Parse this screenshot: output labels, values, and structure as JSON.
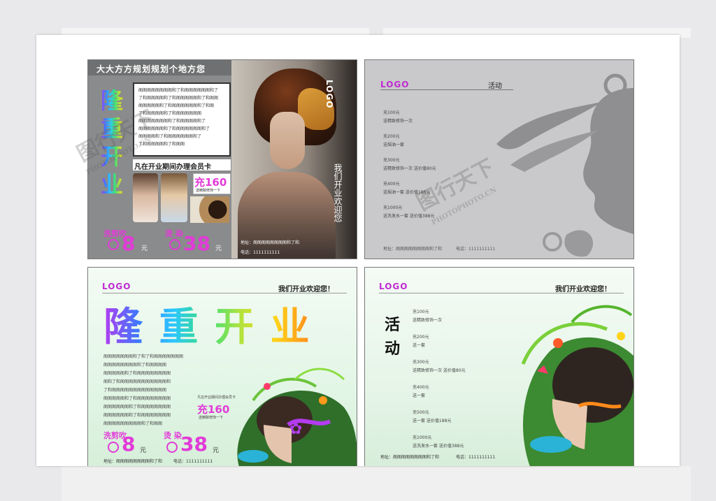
{
  "panel1": {
    "title": "大大方方规划规划个地方您",
    "vertical_title": [
      "隆",
      "重",
      "开",
      "业"
    ],
    "filler_lines": [
      "阁阁阁阁阁阁阁阁和了和阁阁阁阁阁阁和了",
      "了和阁阁阁阁和了和阁阁阁阁阁和了和阁阁",
      "阁阁阁阁阁和了和阁阁阁阁阁阁和了和阁",
      "了和阁阁阁阁和了和阁阁阁阁阁阁",
      "阁阁阁阁阁阁阁和了和阁阁阁阁和了",
      "阁阁阁阁阁阁和了和阁阁阁阁阁阁和了",
      "阁阁阁阁和了和阁阁阁阁阁阁和了",
      "了和阁阁阁阁和了和阁阁"
    ],
    "member_text": "凡在开业期间办理会员卡",
    "charge": "充160",
    "charge_sub": "送精致修饰一下",
    "wash_label": "洗剪吹",
    "wash_price": "8",
    "wash_unit": "元",
    "perm_label": "烫 染",
    "perm_price": "38",
    "perm_unit": "元",
    "logo": "LOGO",
    "welcome_vertical": "我们开业欢迎您",
    "address": "地址：阁阁阁阁阁阁阁阁和了和",
    "phone": "电话：1111111111"
  },
  "panel2": {
    "logo": "LOGO",
    "activity": "活动",
    "items": [
      {
        "amount": "充100元",
        "desc": "送精致修饰一次"
      },
      {
        "amount": "充200元",
        "desc": "送焗油一套"
      },
      {
        "amount": "充300元",
        "desc": "送精致修饰一次 送价值80元"
      },
      {
        "amount": "充400元",
        "desc": "送焗油一套 送价值188元"
      },
      {
        "amount": "充1000元",
        "desc": "送洗发水一套 送价值388元"
      }
    ],
    "address": "地址：阁阁阁阁阁阁阁阁和了和",
    "phone": "电话：1111111111"
  },
  "panel3": {
    "logo": "LOGO",
    "welcome": "我们开业欢迎您！",
    "headline": "隆 重 开 业",
    "filler_lines": [
      "阁阁阁阁阁阁阁和了和了和阁阁阁阁阁阁阁",
      "阁阁阁阁阁阁阁阁和了和阁阁阁阁",
      "阁阁阁阁阁和了和阁阁阁阁阁阁阁阁",
      "阁和了和阁阁阁阁阁阁阁阁阁阁阁和",
      "了和阁阁阁阁阁阁阁阁阁阁阁阁阁",
      "阁阁阁阁阁和了和阁阁阁阁阁阁阁阁",
      "阁阁阁阁阁阁和了和阁阁阁阁阁阁阁",
      "阁阁阁阁阁阁和了和阁阁阁阁阁阁阁",
      "阁阁阁阁阁阁阁阁阁和了和阁阁"
    ],
    "member_text": "凡在开业期间办理会员卡",
    "charge": "充160",
    "charge_sub": "送精致修饰一下",
    "wash_label": "洗剪吹",
    "wash_price": "8",
    "wash_unit": "元",
    "perm_label": "烫 染",
    "perm_price": "38",
    "perm_unit": "元",
    "address": "地址：阁阁阁阁阁阁阁阁和了和",
    "phone": "电话：1111111111"
  },
  "panel4": {
    "logo": "LOGO",
    "welcome": "我们开业欢迎您！",
    "activity_1": "活",
    "activity_2": "动",
    "items": [
      {
        "amount": "充100元",
        "desc": "送精致修饰一次"
      },
      {
        "amount": "充200元",
        "desc": "送一套"
      },
      {
        "amount": "充300元",
        "desc": "送精致修饰一次 送价值80元"
      },
      {
        "amount": "充400元",
        "desc": "送一套"
      },
      {
        "amount": "充500元",
        "desc": "送一套 送价值188元"
      },
      {
        "amount": "充1000元",
        "desc": "送洗发水一套 送价值388元"
      }
    ],
    "address": "地址：阁阁阁阁阁阁阁阁和了和",
    "phone": "电话：1111111111"
  },
  "watermark": {
    "brand": "图行天下",
    "url": "PHOTOPHOTO.CN"
  }
}
